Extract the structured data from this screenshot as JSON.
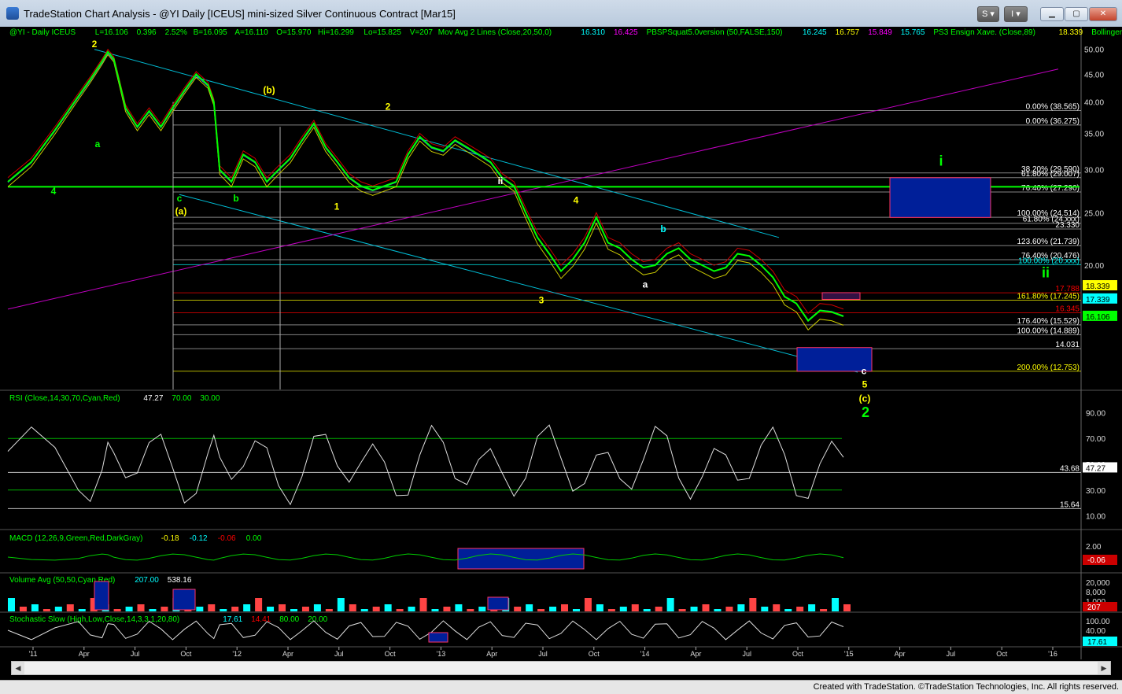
{
  "window": {
    "title": "TradeStation Chart Analysis - @YI Daily [ICEUS] mini-sized Silver Continuous Contract [Mar15]",
    "buttons": {
      "s": "S",
      "i": "I"
    }
  },
  "status": {
    "credit": "Created with TradeStation. ©TradeStation Technologies, Inc. All rights reserved."
  },
  "price_header": [
    {
      "t": "@YI - Daily  ICEUS",
      "c": "#00ff00"
    },
    {
      "t": "L=16.106",
      "c": "#00ff00"
    },
    {
      "t": "0.396",
      "c": "#00ff00"
    },
    {
      "t": "2.52%",
      "c": "#00ff00"
    },
    {
      "t": "B=16.095",
      "c": "#00ff00"
    },
    {
      "t": "A=16.110",
      "c": "#00ff00"
    },
    {
      "t": "O=15.970",
      "c": "#00ff00"
    },
    {
      "t": "Hi=16.299",
      "c": "#00ff00"
    },
    {
      "t": "Lo=15.825",
      "c": "#00ff00"
    },
    {
      "t": "V=207",
      "c": "#00ff00"
    },
    {
      "t": "Mov Avg 2 Lines (Close,20,50,0)",
      "c": "#00ff00"
    },
    {
      "t": "16.310",
      "c": "#00ffff"
    },
    {
      "t": "16.425",
      "c": "#ff00ff"
    },
    {
      "t": "PBSPSquat5.0version (50,FALSE,150)",
      "c": "#00ff00"
    },
    {
      "t": "16.245",
      "c": "#00ffff"
    },
    {
      "t": "16.757",
      "c": "#ffff00"
    },
    {
      "t": "15.849",
      "c": "#ff00ff"
    },
    {
      "t": "15.765",
      "c": "#00ffff"
    },
    {
      "t": "PS3 Ensign Xave. (Close,89)",
      "c": "#00ff00"
    },
    {
      "t": "18.339",
      "c": "#ffff00"
    },
    {
      "t": "Bollinger I ...",
      "c": "#00ff00"
    }
  ],
  "indicator_headers": {
    "rsi": [
      {
        "t": "RSI (Close,14,30,70,Cyan,Red)",
        "c": "#00ff00"
      },
      {
        "t": "47.27",
        "c": "#ffffff"
      },
      {
        "t": "70.00",
        "c": "#00ff00"
      },
      {
        "t": "30.00",
        "c": "#00ff00"
      }
    ],
    "macd": [
      {
        "t": "MACD (12,26,9,Green,Red,DarkGray)",
        "c": "#00ff00"
      },
      {
        "t": "-0.18",
        "c": "#ffff00"
      },
      {
        "t": "-0.12",
        "c": "#00ffff"
      },
      {
        "t": "-0.06",
        "c": "#ff0000"
      },
      {
        "t": "0.00",
        "c": "#00ff00"
      }
    ],
    "volume": [
      {
        "t": "Volume Avg (50,50,Cyan,Red)",
        "c": "#00ff00"
      },
      {
        "t": "207.00",
        "c": "#00ffff"
      },
      {
        "t": "538.16",
        "c": "#ffffff"
      }
    ],
    "stoch": [
      {
        "t": "Stochastic Slow (High,Low,Close,14,3,3,1,20,80)",
        "c": "#00ff00"
      },
      {
        "t": "17.61",
        "c": "#00ffff"
      },
      {
        "t": "14.41",
        "c": "#ff0000"
      },
      {
        "t": "80.00",
        "c": "#00ff00"
      },
      {
        "t": "20.00",
        "c": "#00ff00"
      }
    ]
  },
  "chart_data": {
    "type": "line",
    "instrument": "@YI Daily mini-sized Silver",
    "x_ticks": [
      "'11",
      "Apr",
      "Jul",
      "Oct",
      "'12",
      "Apr",
      "Jul",
      "Oct",
      "'13",
      "Apr",
      "Jul",
      "Oct",
      "'14",
      "Apr",
      "Jul",
      "Oct",
      "'15",
      "Apr",
      "Jul",
      "Oct",
      "'16"
    ],
    "ylim": [
      12,
      52
    ],
    "y_ticks": [
      50,
      45,
      40,
      35,
      30,
      25,
      20
    ],
    "series": [
      {
        "name": "@YI - Daily",
        "color": "#00ff00",
        "points": [
          [
            0,
            28.5
          ],
          [
            2,
            31
          ],
          [
            4,
            35.5
          ],
          [
            6,
            41
          ],
          [
            7,
            44
          ],
          [
            8,
            47.5
          ],
          [
            8.5,
            49.5
          ],
          [
            9,
            48
          ],
          [
            10,
            39
          ],
          [
            11,
            36
          ],
          [
            12,
            38.5
          ],
          [
            13,
            36
          ],
          [
            14,
            39
          ],
          [
            15,
            42
          ],
          [
            16,
            45
          ],
          [
            17,
            43
          ],
          [
            17.5,
            40
          ],
          [
            18,
            30
          ],
          [
            19,
            28.5
          ],
          [
            20,
            32
          ],
          [
            21,
            31
          ],
          [
            22,
            28.5
          ],
          [
            23,
            30
          ],
          [
            24,
            31.5
          ],
          [
            25,
            34
          ],
          [
            26,
            36.5
          ],
          [
            27,
            33
          ],
          [
            28,
            31
          ],
          [
            29,
            29
          ],
          [
            30,
            28
          ],
          [
            31,
            27.5
          ],
          [
            32,
            28
          ],
          [
            33,
            28.5
          ],
          [
            34,
            32
          ],
          [
            35,
            34.5
          ],
          [
            36,
            33
          ],
          [
            37,
            32.5
          ],
          [
            38,
            34
          ],
          [
            39,
            33
          ],
          [
            40,
            32
          ],
          [
            41,
            31
          ],
          [
            42,
            29
          ],
          [
            43,
            28
          ],
          [
            44,
            25
          ],
          [
            45,
            22.5
          ],
          [
            46,
            21
          ],
          [
            47,
            19.5
          ],
          [
            48,
            20.5
          ],
          [
            49,
            22
          ],
          [
            50,
            24.5
          ],
          [
            51,
            22
          ],
          [
            52,
            21.5
          ],
          [
            53,
            20.5
          ],
          [
            54,
            19.8
          ],
          [
            55,
            20
          ],
          [
            56,
            21
          ],
          [
            57,
            21.5
          ],
          [
            58,
            20.5
          ],
          [
            59,
            20
          ],
          [
            60,
            19.5
          ],
          [
            61,
            19.8
          ],
          [
            62,
            21
          ],
          [
            63,
            20.8
          ],
          [
            64,
            20
          ],
          [
            65,
            19
          ],
          [
            66,
            17.5
          ],
          [
            67,
            17
          ],
          [
            68,
            15.8
          ],
          [
            69,
            16.5
          ],
          [
            70,
            16.4
          ],
          [
            71,
            16.1
          ]
        ]
      }
    ],
    "annotations": [
      {
        "t": "2",
        "c": "#ffff00"
      },
      {
        "t": "4",
        "c": "#00ff00"
      },
      {
        "t": "a",
        "c": "#00ff00"
      },
      {
        "t": "c",
        "c": "#00ff00"
      },
      {
        "t": "(a)",
        "c": "#ffff00"
      },
      {
        "t": "b",
        "c": "#00ff00"
      },
      {
        "t": "(b)",
        "c": "#ffff00"
      },
      {
        "t": "1",
        "c": "#ffff00"
      },
      {
        "t": "2",
        "c": "#ffff00"
      },
      {
        "t": "ii",
        "c": "#ffffff"
      },
      {
        "t": "3",
        "c": "#ffff00"
      },
      {
        "t": "4",
        "c": "#ffff00"
      },
      {
        "t": "a",
        "c": "#ffffff"
      },
      {
        "t": "b",
        "c": "#00ffff"
      },
      {
        "t": "c",
        "c": "#ffffff"
      },
      {
        "t": "5",
        "c": "#ffff00"
      },
      {
        "t": "(c)",
        "c": "#ffff00"
      },
      {
        "t": "2",
        "c": "#00ff00"
      },
      {
        "t": "i",
        "c": "#00ff00"
      },
      {
        "t": "ii",
        "c": "#00ff00"
      }
    ],
    "fib_labels": [
      {
        "t": "0.00% (38.565)",
        "c": "#ffffff",
        "v": 38.565
      },
      {
        "t": "0.00% (36.275)",
        "c": "#ffffff",
        "v": 36.275
      },
      {
        "t": "38.20% (29.590)",
        "c": "#ffffff",
        "v": 29.59
      },
      {
        "t": "61.80% (29.007)",
        "c": "#ffffff",
        "v": 29.007
      },
      {
        "t": "76.40% (27.290)",
        "c": "#ffffff",
        "v": 27.29
      },
      {
        "t": "100.00% (24.514)",
        "c": "#ffffff",
        "v": 24.514
      },
      {
        "t": "61.80% (24.xxx)",
        "c": "#ffffff",
        "v": 23.9
      },
      {
        "t": "23.330",
        "c": "#ffffff",
        "v": 23.33
      },
      {
        "t": "123.60% (21.739)",
        "c": "#ffffff",
        "v": 21.739
      },
      {
        "t": "76.40% (20.476)",
        "c": "#ffffff",
        "v": 20.476
      },
      {
        "t": "100.00% (20.xxx)",
        "c": "#00ffff",
        "v": 20.05
      },
      {
        "t": "17.788",
        "c": "#ff0000",
        "v": 17.788
      },
      {
        "t": "161.80% (17.245)",
        "c": "#ffff00",
        "v": 17.245
      },
      {
        "t": "16.345",
        "c": "#ff0000",
        "v": 16.345
      },
      {
        "t": "176.40% (15.529)",
        "c": "#ffffff",
        "v": 15.529
      },
      {
        "t": "100.00% (14.889)",
        "c": "#ffffff",
        "v": 14.889
      },
      {
        "t": "14.031",
        "c": "#ffffff",
        "v": 14.031
      },
      {
        "t": "200.00% (12.753)",
        "c": "#ffff00",
        "v": 12.753
      }
    ],
    "axis_badges": [
      {
        "t": "18.339",
        "bg": "#ffff00",
        "fg": "#000000"
      },
      {
        "t": "17.339",
        "bg": "#00ffff",
        "fg": "#000000"
      },
      {
        "t": "16.106",
        "bg": "#00ff00",
        "fg": "#000000"
      }
    ],
    "rsi": {
      "ylim": [
        0,
        100
      ],
      "y_ticks": [
        90,
        70,
        50,
        30,
        10
      ],
      "levels": [
        70,
        30
      ],
      "labels": [
        {
          "t": "43.68",
          "c": "#ffffff"
        },
        {
          "t": "15.64",
          "c": "#ffffff"
        }
      ],
      "current": "47.27"
    },
    "macd": {
      "y_ticks": [
        "2.00",
        "-0.06"
      ]
    },
    "volume": {
      "y_ticks": [
        "20,000",
        "8,000",
        "1,000"
      ],
      "current": "207"
    },
    "stoch": {
      "y_ticks": [
        "100.00",
        "40.00"
      ],
      "current": "17.61"
    }
  }
}
